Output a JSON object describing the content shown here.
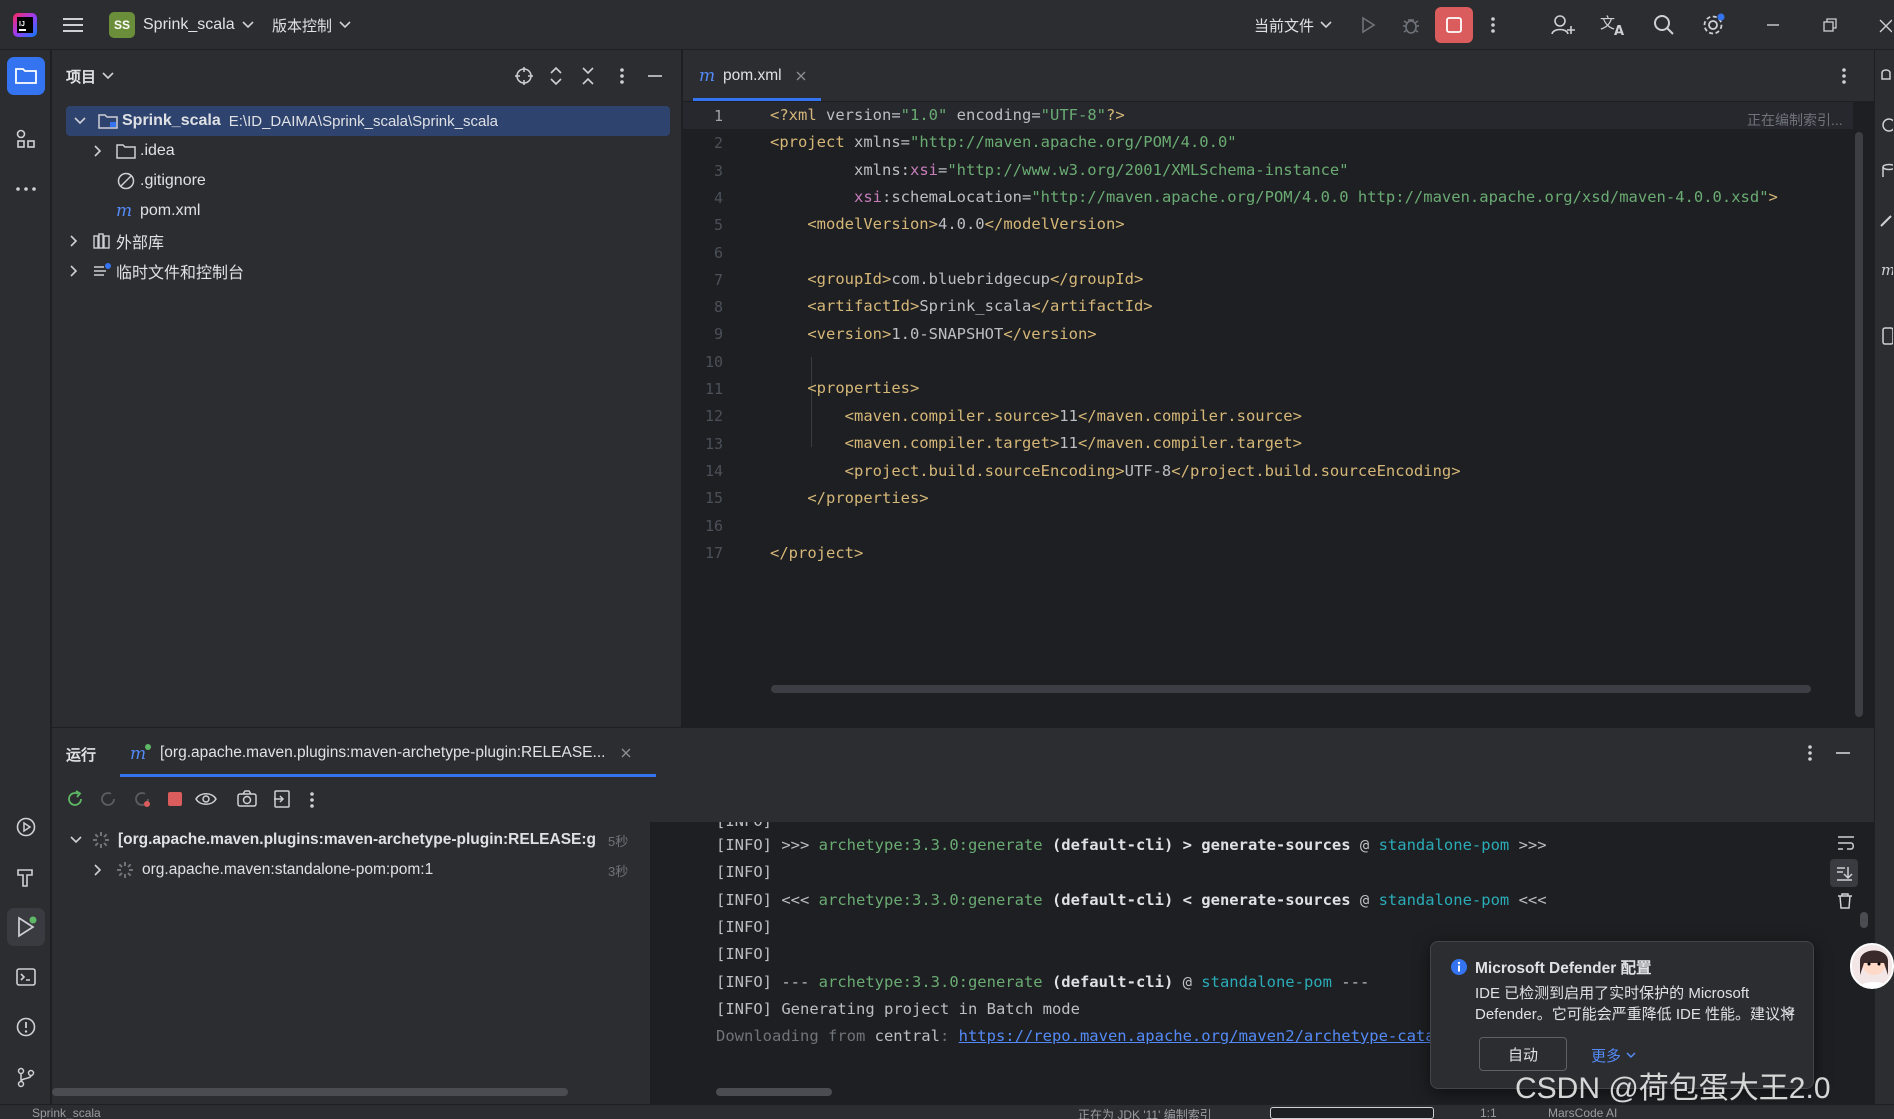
{
  "titlebar": {
    "project_badge": "SS",
    "project_name": "Sprink_scala",
    "vcs_label": "版本控制",
    "run_config": "当前文件"
  },
  "project_panel": {
    "title": "项目",
    "items": [
      {
        "label": "Sprink_scala",
        "path": "E:\\ID_DAIMA\\Sprink_scala\\Sprink_scala"
      },
      {
        "label": ".idea"
      },
      {
        "label": ".gitignore"
      },
      {
        "label": "pom.xml"
      },
      {
        "label": "外部库"
      },
      {
        "label": "临时文件和控制台"
      }
    ]
  },
  "editor": {
    "tab_label": "pom.xml",
    "indexing_hint": "正在编制索引...",
    "line_numbers": [
      "1",
      "2",
      "3",
      "4",
      "5",
      "6",
      "7",
      "8",
      "9",
      "10",
      "11",
      "12",
      "13",
      "14",
      "15",
      "16",
      "17"
    ]
  },
  "code": {
    "l1": {
      "a": "<?xml ",
      "b": "version=",
      "c": "\"1.0\"",
      "d": " encoding=",
      "e": "\"UTF-8\"",
      "f": "?>"
    },
    "l2": {
      "a": "<project ",
      "b": "xmlns=",
      "c": "\"http://maven.apache.org/POM/4.0.0\""
    },
    "l3": {
      "a": "         xmlns:",
      "b": "xsi",
      "c": "=",
      "d": "\"http://www.w3.org/2001/XMLSchema-instance\""
    },
    "l4": {
      "a": "         ",
      "b": "xsi",
      "c": ":schemaLocation=",
      "d": "\"http://maven.apache.org/POM/4.0.0 http://maven.apache.org/xsd/maven-4.0.0.xsd\"",
      "e": ">"
    },
    "l5": {
      "a": "    <modelVersion>",
      "b": "4.0.0",
      "c": "</modelVersion>"
    },
    "l7": {
      "a": "    <groupId>",
      "b": "com.bluebridgecup",
      "c": "</groupId>"
    },
    "l8": {
      "a": "    <artifactId>",
      "b": "Sprink_scala",
      "c": "</artifactId>"
    },
    "l9": {
      "a": "    <version>",
      "b": "1.0-SNAPSHOT",
      "c": "</version>"
    },
    "l11": {
      "a": "    <properties>"
    },
    "l12": {
      "a": "        <maven.compiler.source>",
      "b": "11",
      "c": "</maven.compiler.source>"
    },
    "l13": {
      "a": "        <maven.compiler.target>",
      "b": "11",
      "c": "</maven.compiler.target>"
    },
    "l14": {
      "a": "        <project.build.sourceEncoding>",
      "b": "UTF-8",
      "c": "</project.build.sourceEncoding>"
    },
    "l15": {
      "a": "    </properties>"
    },
    "l17": {
      "a": "</project>"
    }
  },
  "run_panel": {
    "title": "运行",
    "tab_label": "[org.apache.maven.plugins:maven-archetype-plugin:RELEASE...",
    "tree": [
      {
        "label": "[org.apache.maven.plugins:maven-archetype-plugin:RELEASE:g",
        "time": "5秒"
      },
      {
        "label": "org.apache.maven:standalone-pom:pom:1",
        "time": "3秒"
      }
    ]
  },
  "console": {
    "info": "[INFO]",
    "l2": {
      "a": " >>> ",
      "b": "archetype:3.3.0:generate",
      "c": " (default-cli) > generate-sources ",
      "d": "@ ",
      "e": "standalone-pom",
      "f": " >>>"
    },
    "l4": {
      "a": " <<< ",
      "b": "archetype:3.3.0:generate",
      "c": " (default-cli) < generate-sources ",
      "d": "@ ",
      "e": "standalone-pom",
      "f": " <<<"
    },
    "l7": {
      "a": " --- ",
      "b": "archetype:3.3.0:generate",
      "c": " (default-cli) ",
      "d": "@ ",
      "e": "standalone-pom",
      "f": " ---"
    },
    "l8": " Generating project in Batch mode",
    "l9": {
      "a": "Downloading from ",
      "b": "central",
      "c": ": ",
      "d": "https://repo.maven.apache.org/maven2/archetype-cata"
    }
  },
  "notification": {
    "title": "Microsoft Defender 配置",
    "body1": "IDE 已检测到启用了实时保护的 Microsoft",
    "body2": "Defender。它可能会严重降低 IDE 性能。建议将",
    "btn_auto": "自动",
    "btn_more": "更多"
  },
  "statusbar": {
    "left": "Sprink_scala",
    "middle": "正在为 JDK '11' 编制索引",
    "pos": "1:1",
    "plugin": "MarsCode AI"
  },
  "watermark": "CSDN @荷包蛋大王2.0",
  "colors": {
    "accent": "#3574f0",
    "stop_red": "#db5c5c",
    "xml_tag": "#d5b778",
    "xml_string": "#6aab73",
    "teal": "#2aacb8"
  }
}
